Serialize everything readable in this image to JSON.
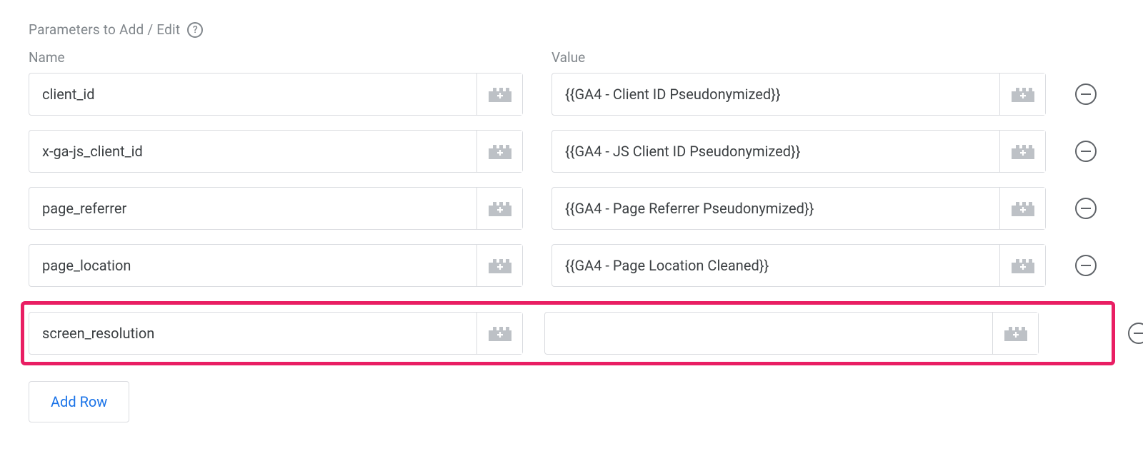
{
  "section": {
    "title": "Parameters to Add / Edit"
  },
  "columns": {
    "name": "Name",
    "value": "Value"
  },
  "rows": [
    {
      "name": "client_id",
      "value": "{{GA4 - Client ID Pseudonymized}}",
      "highlighted": false
    },
    {
      "name": "x-ga-js_client_id",
      "value": "{{GA4 - JS Client ID Pseudonymized}}",
      "highlighted": false
    },
    {
      "name": "page_referrer",
      "value": "{{GA4 - Page Referrer Pseudonymized}}",
      "highlighted": false
    },
    {
      "name": "page_location",
      "value": "{{GA4 - Page Location Cleaned}}",
      "highlighted": false
    },
    {
      "name": "screen_resolution",
      "value": "",
      "highlighted": true
    }
  ],
  "buttons": {
    "add_row": "Add Row"
  }
}
